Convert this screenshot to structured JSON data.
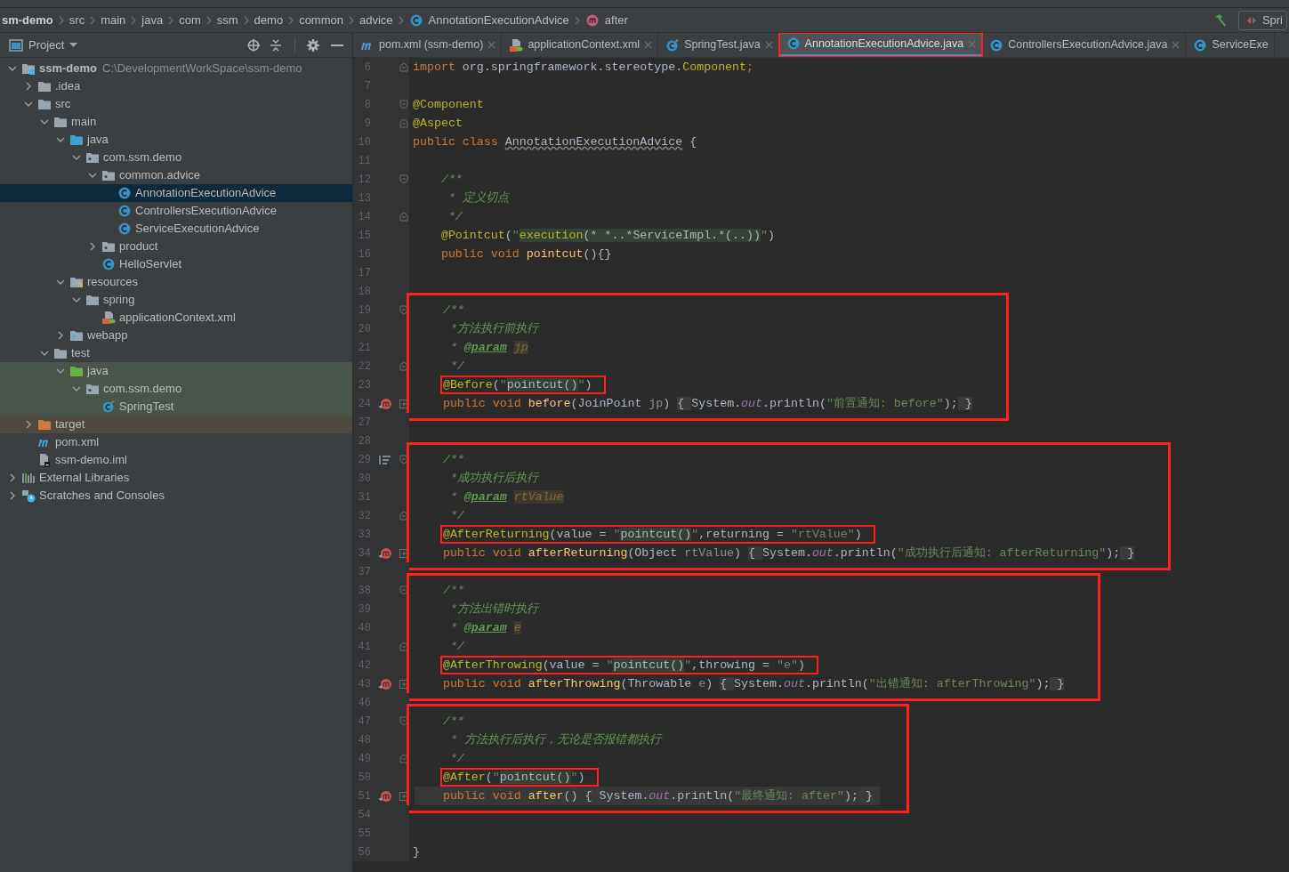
{
  "breadcrumb": [
    {
      "label": "sm-demo"
    },
    {
      "label": "src"
    },
    {
      "label": "main"
    },
    {
      "label": "java"
    },
    {
      "label": "com"
    },
    {
      "label": "ssm"
    },
    {
      "label": "demo"
    },
    {
      "label": "common"
    },
    {
      "label": "advice"
    },
    {
      "label": "AnnotationExecutionAdvice",
      "kind": "class"
    },
    {
      "label": "after",
      "kind": "method"
    }
  ],
  "run_config": {
    "label": "Spri"
  },
  "project_panel": {
    "title": "Project",
    "tree": [
      {
        "label": "ssm-demo",
        "kind": "module",
        "path": "C:\\DevelopmentWorkSpace\\ssm-demo",
        "expanded": true,
        "children": [
          {
            "label": ".idea",
            "kind": "folder",
            "expanded": false
          },
          {
            "label": "src",
            "kind": "folder",
            "expanded": true,
            "children": [
              {
                "label": "main",
                "kind": "folder",
                "expanded": true,
                "children": [
                  {
                    "label": "java",
                    "kind": "source-folder",
                    "expanded": true,
                    "children": [
                      {
                        "label": "com.ssm.demo",
                        "kind": "package",
                        "expanded": true,
                        "children": [
                          {
                            "label": "common.advice",
                            "kind": "package",
                            "expanded": true,
                            "children": [
                              {
                                "label": "AnnotationExecutionAdvice",
                                "kind": "class",
                                "selected": true
                              },
                              {
                                "label": "ControllersExecutionAdvice",
                                "kind": "class",
                                "selected": false
                              },
                              {
                                "label": "ServiceExecutionAdvice",
                                "kind": "class",
                                "selected": false
                              }
                            ]
                          },
                          {
                            "label": "product",
                            "kind": "package",
                            "expanded": false
                          },
                          {
                            "label": "HelloServlet",
                            "kind": "class",
                            "selected": false
                          }
                        ]
                      }
                    ]
                  },
                  {
                    "label": "resources",
                    "kind": "resources-folder",
                    "expanded": true,
                    "children": [
                      {
                        "label": "spring",
                        "kind": "folder",
                        "expanded": true,
                        "children": [
                          {
                            "label": "applicationContext.xml",
                            "kind": "spring-xml",
                            "selected": false
                          }
                        ]
                      }
                    ]
                  },
                  {
                    "label": "webapp",
                    "kind": "web-folder",
                    "expanded": false
                  }
                ]
              },
              {
                "label": "test",
                "kind": "folder",
                "expanded": true,
                "children": [
                  {
                    "label": "java",
                    "kind": "test-folder",
                    "expanded": true,
                    "children": [
                      {
                        "label": "com.ssm.demo",
                        "kind": "test-package",
                        "expanded": true,
                        "children": [
                          {
                            "label": "SpringTest",
                            "kind": "test-class",
                            "selected": false
                          }
                        ]
                      }
                    ]
                  }
                ]
              }
            ]
          },
          {
            "label": "target",
            "kind": "excluded-folder",
            "expanded": false
          },
          {
            "label": "pom.xml",
            "kind": "maven",
            "selected": false
          },
          {
            "label": "ssm-demo.iml",
            "kind": "iml",
            "selected": false
          }
        ]
      },
      {
        "label": "External Libraries",
        "kind": "libraries",
        "expanded": false
      },
      {
        "label": "Scratches and Consoles",
        "kind": "scratches",
        "expanded": false
      }
    ]
  },
  "tabs": [
    {
      "label": "pom.xml (ssm-demo)",
      "kind": "maven",
      "selected": false,
      "framed": false,
      "closable": true
    },
    {
      "label": "applicationContext.xml",
      "kind": "spring-xml",
      "selected": false,
      "framed": false,
      "closable": true
    },
    {
      "label": "SpringTest.java",
      "kind": "test-class",
      "selected": false,
      "framed": false,
      "closable": true
    },
    {
      "label": "AnnotationExecutionAdvice.java",
      "kind": "class",
      "selected": true,
      "framed": true,
      "closable": true
    },
    {
      "label": "ControllersExecutionAdvice.java",
      "kind": "class",
      "selected": false,
      "framed": false,
      "closable": true
    },
    {
      "label": "ServiceExe",
      "kind": "class",
      "selected": false,
      "framed": false,
      "closable": false
    }
  ],
  "editor": {
    "sections": [
      {
        "framed": false,
        "lines": [
          {
            "no": "6",
            "fold_end": true,
            "tokens": [
              {
                "t": "import",
                "kind": "kw"
              },
              {
                "t": " org.springframework.stereotype.",
                "kind": "plain"
              },
              {
                "t": "Component",
                "kind": "ann"
              },
              {
                "t": ";",
                "kind": "kw"
              }
            ]
          },
          {
            "no": "7"
          },
          {
            "no": "8",
            "fold_start": true,
            "tokens": [
              {
                "t": "@Component",
                "kind": "ann"
              }
            ]
          },
          {
            "no": "9",
            "fold_end": true,
            "tokens": [
              {
                "t": "@Aspect",
                "kind": "ann"
              }
            ]
          },
          {
            "no": "10",
            "tokens": [
              {
                "t": "public class ",
                "kind": "kw"
              },
              {
                "t": "AnnotationExecutionAdvice",
                "kind": "wavy"
              },
              {
                "t": " {",
                "kind": "plain"
              }
            ]
          },
          {
            "no": "11"
          },
          {
            "no": "12",
            "fold_start": true,
            "indented": true,
            "tokens": [
              {
                "t": "/**",
                "kind": "doc"
              }
            ]
          },
          {
            "no": "13",
            "indented": true,
            "tokens": [
              {
                "t": " * 定义切点",
                "kind": "doc"
              }
            ]
          },
          {
            "no": "14",
            "fold_end": true,
            "indented": true,
            "tokens": [
              {
                "t": " */",
                "kind": "doc"
              }
            ]
          },
          {
            "no": "15",
            "indented": true,
            "tokens": [
              {
                "t": "@Pointcut",
                "kind": "ann"
              },
              {
                "t": "(",
                "kind": "plain"
              },
              {
                "t": "\"",
                "kind": "str"
              },
              {
                "t": "execution",
                "kind": "injkw"
              },
              {
                "t": "(* *..*ServiceImpl.*(..))",
                "kind": "inj"
              },
              {
                "t": "\"",
                "kind": "str"
              },
              {
                "t": ")",
                "kind": "plain"
              }
            ]
          },
          {
            "no": "16",
            "indented": true,
            "tokens": [
              {
                "t": "public void ",
                "kind": "kw"
              },
              {
                "t": "pointcut",
                "kind": "fn"
              },
              {
                "t": "(){}",
                "kind": "plain"
              }
            ]
          },
          {
            "no": "17"
          },
          {
            "no": "18"
          }
        ]
      },
      {
        "framed": true,
        "lines": [
          {
            "no": "19",
            "fold_start": true,
            "indented": true,
            "tokens": [
              {
                "t": "/**",
                "kind": "doc"
              }
            ]
          },
          {
            "no": "20",
            "indented": true,
            "tokens": [
              {
                "t": " *方法执行前执行",
                "kind": "doc"
              }
            ]
          },
          {
            "no": "21",
            "indented": true,
            "tokens": [
              {
                "t": " * ",
                "kind": "doc"
              },
              {
                "t": "@param",
                "kind": "tag"
              },
              {
                "t": "jp",
                "kind": "param"
              }
            ]
          },
          {
            "no": "22",
            "fold_end": true,
            "indented": true,
            "tokens": [
              {
                "t": " */",
                "kind": "doc"
              }
            ]
          },
          {
            "no": "23",
            "indented": true,
            "boxed": true,
            "tokens": [
              {
                "t": "@Before",
                "kind": "ann"
              },
              {
                "t": "(",
                "kind": "plain"
              },
              {
                "t": "\"",
                "kind": "str"
              },
              {
                "t": "pointcut()",
                "kind": "inj"
              },
              {
                "t": "\"",
                "kind": "str"
              },
              {
                "t": ")",
                "kind": "plain"
              }
            ]
          },
          {
            "no": "24",
            "advice_marker": true,
            "collapsed_fold": true,
            "indented": true,
            "tokens": [
              {
                "t": "public void ",
                "kind": "kw"
              },
              {
                "t": "before",
                "kind": "fn"
              },
              {
                "t": "(JoinPoint ",
                "kind": "plain"
              },
              {
                "t": "jp",
                "kind": "unused"
              },
              {
                "t": ") ",
                "kind": "plain"
              },
              {
                "t": "{ ",
                "kind": "folded"
              },
              {
                "t": "System.",
                "kind": "plain"
              },
              {
                "t": "out",
                "kind": "field"
              },
              {
                "t": ".println(",
                "kind": "plain"
              },
              {
                "t": "\"前置通知: before\"",
                "kind": "str"
              },
              {
                "t": ");",
                "kind": "plain"
              },
              {
                "t": " }",
                "kind": "folded"
              }
            ]
          }
        ]
      },
      {
        "framed": false,
        "lines": [
          {
            "no": "27"
          },
          {
            "no": "28"
          }
        ]
      },
      {
        "framed": true,
        "lines": [
          {
            "no": "29",
            "structure_marker": true,
            "fold_start": true,
            "indented": true,
            "tokens": [
              {
                "t": "/**",
                "kind": "doc"
              }
            ]
          },
          {
            "no": "30",
            "indented": true,
            "tokens": [
              {
                "t": " *成功执行后执行",
                "kind": "doc"
              }
            ]
          },
          {
            "no": "31",
            "indented": true,
            "tokens": [
              {
                "t": " * ",
                "kind": "doc"
              },
              {
                "t": "@param",
                "kind": "tag"
              },
              {
                "t": "rtValue",
                "kind": "param"
              }
            ]
          },
          {
            "no": "32",
            "fold_end": true,
            "indented": true,
            "tokens": [
              {
                "t": " */",
                "kind": "doc"
              }
            ]
          },
          {
            "no": "33",
            "indented": true,
            "boxed": true,
            "tokens": [
              {
                "t": "@AfterReturning",
                "kind": "ann"
              },
              {
                "t": "(value = ",
                "kind": "plain"
              },
              {
                "t": "\"",
                "kind": "str"
              },
              {
                "t": "pointcut()",
                "kind": "inj"
              },
              {
                "t": "\"",
                "kind": "str"
              },
              {
                "t": ",returning = ",
                "kind": "plain"
              },
              {
                "t": "\"rtValue\"",
                "kind": "str"
              },
              {
                "t": ")",
                "kind": "plain"
              }
            ]
          },
          {
            "no": "34",
            "advice_marker": true,
            "collapsed_fold": true,
            "indented": true,
            "tokens": [
              {
                "t": "public void ",
                "kind": "kw"
              },
              {
                "t": "afterReturning",
                "kind": "fn"
              },
              {
                "t": "(Object ",
                "kind": "plain"
              },
              {
                "t": "rtValue",
                "kind": "unused"
              },
              {
                "t": ") ",
                "kind": "plain"
              },
              {
                "t": "{ ",
                "kind": "folded"
              },
              {
                "t": "System.",
                "kind": "plain"
              },
              {
                "t": "out",
                "kind": "field"
              },
              {
                "t": ".println(",
                "kind": "plain"
              },
              {
                "t": "\"成功执行后通知: afterReturning\"",
                "kind": "str"
              },
              {
                "t": ");",
                "kind": "plain"
              },
              {
                "t": " }",
                "kind": "folded"
              }
            ]
          }
        ]
      },
      {
        "framed": false,
        "lines": [
          {
            "no": "37"
          }
        ]
      },
      {
        "framed": true,
        "lines": [
          {
            "no": "38",
            "fold_start": true,
            "indented": true,
            "tokens": [
              {
                "t": "/**",
                "kind": "doc"
              }
            ]
          },
          {
            "no": "39",
            "indented": true,
            "tokens": [
              {
                "t": " *方法出错时执行",
                "kind": "doc"
              }
            ]
          },
          {
            "no": "40",
            "indented": true,
            "tokens": [
              {
                "t": " * ",
                "kind": "doc"
              },
              {
                "t": "@param",
                "kind": "tag"
              },
              {
                "t": "e",
                "kind": "param"
              }
            ]
          },
          {
            "no": "41",
            "fold_end": true,
            "indented": true,
            "tokens": [
              {
                "t": " */",
                "kind": "doc"
              }
            ]
          },
          {
            "no": "42",
            "indented": true,
            "boxed": true,
            "tokens": [
              {
                "t": "@AfterThrowing",
                "kind": "ann"
              },
              {
                "t": "(value = ",
                "kind": "plain"
              },
              {
                "t": "\"",
                "kind": "str"
              },
              {
                "t": "pointcut()",
                "kind": "inj"
              },
              {
                "t": "\"",
                "kind": "str"
              },
              {
                "t": ",throwing = ",
                "kind": "plain"
              },
              {
                "t": "\"e\"",
                "kind": "str"
              },
              {
                "t": ")",
                "kind": "plain"
              }
            ]
          },
          {
            "no": "43",
            "advice_marker": true,
            "collapsed_fold": true,
            "indented": true,
            "tokens": [
              {
                "t": "public void ",
                "kind": "kw"
              },
              {
                "t": "afterThrowing",
                "kind": "fn"
              },
              {
                "t": "(Throwable ",
                "kind": "plain"
              },
              {
                "t": "e",
                "kind": "unused"
              },
              {
                "t": ") ",
                "kind": "plain"
              },
              {
                "t": "{ ",
                "kind": "folded"
              },
              {
                "t": "System.",
                "kind": "plain"
              },
              {
                "t": "out",
                "kind": "field"
              },
              {
                "t": ".println(",
                "kind": "plain"
              },
              {
                "t": "\"出错通知: afterThrowing\"",
                "kind": "str"
              },
              {
                "t": ");",
                "kind": "plain"
              },
              {
                "t": " }",
                "kind": "folded"
              }
            ]
          }
        ]
      },
      {
        "framed": false,
        "lines": [
          {
            "no": "46"
          }
        ]
      },
      {
        "framed": true,
        "lines": [
          {
            "no": "47",
            "fold_start": true,
            "indented": true,
            "tokens": [
              {
                "t": "/**",
                "kind": "doc"
              }
            ]
          },
          {
            "no": "48",
            "indented": true,
            "tokens": [
              {
                "t": " * 方法执行后执行，无论是否报错都执行",
                "kind": "doc"
              }
            ]
          },
          {
            "no": "49",
            "fold_end": true,
            "indented": true,
            "tokens": [
              {
                "t": " */",
                "kind": "doc"
              }
            ]
          },
          {
            "no": "50",
            "indented": true,
            "boxed": true,
            "tokens": [
              {
                "t": "@After",
                "kind": "ann"
              },
              {
                "t": "(",
                "kind": "plain"
              },
              {
                "t": "\"",
                "kind": "str"
              },
              {
                "t": "pointcut()",
                "kind": "inj"
              },
              {
                "t": "\"",
                "kind": "str"
              },
              {
                "t": ")",
                "kind": "plain"
              }
            ]
          },
          {
            "no": "51",
            "advice_marker": true,
            "collapsed_fold": true,
            "current": true,
            "indented": true,
            "tokens": [
              {
                "t": "public void ",
                "kind": "kw"
              },
              {
                "t": "after",
                "kind": "fn"
              },
              {
                "t": "() ",
                "kind": "plain"
              },
              {
                "t": "{ ",
                "kind": "folded"
              },
              {
                "t": "System.",
                "kind": "plain"
              },
              {
                "t": "out",
                "kind": "field"
              },
              {
                "t": ".println(",
                "kind": "plain"
              },
              {
                "t": "\"最终通知: after\"",
                "kind": "str"
              },
              {
                "t": ");",
                "kind": "plain"
              },
              {
                "t": " }",
                "kind": "folded"
              }
            ]
          }
        ]
      },
      {
        "framed": false,
        "lines": [
          {
            "no": "54"
          },
          {
            "no": "55"
          },
          {
            "no": "56",
            "tokens": [
              {
                "t": "}",
                "kind": "plain"
              }
            ]
          }
        ]
      }
    ]
  }
}
